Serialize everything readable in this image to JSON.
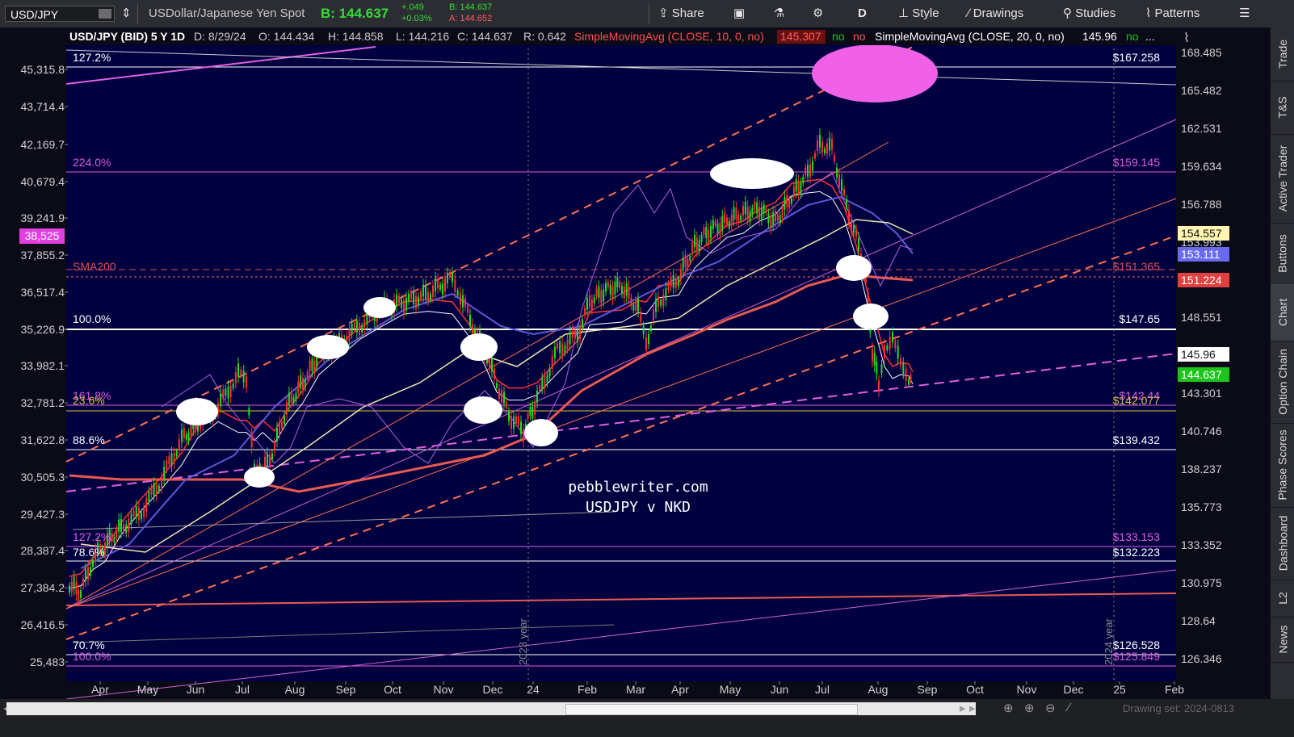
{
  "toolbar": {
    "symbol": "USD/JPY",
    "description": "USDollar/Japanese Yen Spot",
    "bid": "B: 144.637",
    "change": "+.049",
    "change_pct": "+0.03%",
    "bid_small": "B: 144.637",
    "ask_small": "A: 144.652",
    "share": "Share",
    "period": "D",
    "style": "Style",
    "drawings": "Drawings",
    "studies": "Studies",
    "patterns": "Patterns"
  },
  "header": {
    "instrument": "USD/JPY (BID) 5 Y 1D",
    "date": "D: 8/29/24",
    "open": "O: 144.434",
    "high": "H: 144.858",
    "low": "L: 144.216",
    "close": "C: 144.637",
    "range": "R: 0.642",
    "sma10": "SimpleMovingAvg (CLOSE, 10, 0, no)",
    "sma10_val": "145.307",
    "sma10_no1": "no",
    "sma10_no2": "no",
    "sma20": "SimpleMovingAvg (CLOSE, 20, 0, no)",
    "sma20_val": "145.96",
    "sma20_no": "no",
    "more": "..."
  },
  "left_axis": [
    "45,315.8",
    "43,714.4",
    "42,169.7",
    "40,679.4",
    "39,241.9",
    "37,855.2",
    "36,517.4",
    "35,226.9",
    "33,982.1",
    "32,781.2",
    "31,622.8",
    "30,505.3",
    "29,427.3",
    "28,387.4",
    "27,384.2",
    "26,416.5",
    "25,483"
  ],
  "left_marker": "38,525",
  "right_axis": [
    "168.485",
    "165.482",
    "162.531",
    "159.634",
    "156.788",
    "153.993",
    "151.245",
    "148.551",
    "145.960",
    "143.301",
    "140.746",
    "138.237",
    "135.773",
    "133.352",
    "130.975",
    "128.64",
    "126.346"
  ],
  "right_markers": [
    {
      "text": "154.557",
      "bg": "#fff4b0",
      "fg": "#111"
    },
    {
      "text": "153.111",
      "bg": "#6a6af0",
      "fg": "#fff"
    },
    {
      "text": "151.224",
      "bg": "#e04040",
      "fg": "#fff"
    },
    {
      "text": "145.96",
      "bg": "#ffffff",
      "fg": "#111"
    },
    {
      "text": "144.637",
      "bg": "#1ec41e",
      "fg": "#fff"
    }
  ],
  "fib_left": [
    {
      "text": "127.2%",
      "color": "#ffffff"
    },
    {
      "text": "224.0%",
      "color": "#e05ce0"
    },
    {
      "text": "SMA200",
      "color": "#e05050"
    },
    {
      "text": "100.0%",
      "color": "#ffffff"
    },
    {
      "text": "161.8%",
      "color": "#e05ce0"
    },
    {
      "text": "23.6%",
      "color": "#d8c040"
    },
    {
      "text": "88.6%",
      "color": "#ffffff"
    },
    {
      "text": "127.2%",
      "color": "#e05ce0"
    },
    {
      "text": "78.6%",
      "color": "#ffffff"
    },
    {
      "text": "70.7%",
      "color": "#ffffff"
    },
    {
      "text": "100.0%",
      "color": "#e05ce0"
    }
  ],
  "fib_right": [
    {
      "text": "$167.258",
      "color": "#ffffff"
    },
    {
      "text": "$159.145",
      "color": "#e05ce0"
    },
    {
      "text": "$151.365",
      "color": "#e05050"
    },
    {
      "text": "$147.65",
      "color": "#ffffff"
    },
    {
      "text": "$142.44",
      "color": "#e05ce0"
    },
    {
      "text": "$142.077",
      "color": "#d8c040"
    },
    {
      "text": "$139.432",
      "color": "#ffffff"
    },
    {
      "text": "$133.153",
      "color": "#e05ce0"
    },
    {
      "text": "$132.223",
      "color": "#ffffff"
    },
    {
      "text": "$126.528",
      "color": "#ffffff"
    },
    {
      "text": "$125.849",
      "color": "#e05ce0"
    }
  ],
  "months": [
    "Apr",
    "May",
    "Jun",
    "Jul",
    "Aug",
    "Sep",
    "Oct",
    "Nov",
    "Dec",
    "24",
    "Feb",
    "Mar",
    "Apr",
    "May",
    "Jun",
    "Jul",
    "Aug",
    "Sep",
    "Oct",
    "Nov",
    "Dec",
    "25",
    "Feb"
  ],
  "year_labels": [
    "2023 year",
    "2024 year"
  ],
  "watermark": [
    "pebblewriter.com",
    "USDJPY v NKD"
  ],
  "sidebar_tabs": [
    "Trade",
    "T&S",
    "Active Trader",
    "Buttons",
    "Chart",
    "Option Chain",
    "Phase Scores",
    "Dashboard",
    "L2",
    "News"
  ],
  "drawing_set": "Drawing set: 2024-0813",
  "colors": {
    "bg": "#01013f",
    "sma200": "#e85a50",
    "sma50": "#5a5ad8",
    "nkd": "#b060e0",
    "sma100": "#f0e8b0"
  }
}
